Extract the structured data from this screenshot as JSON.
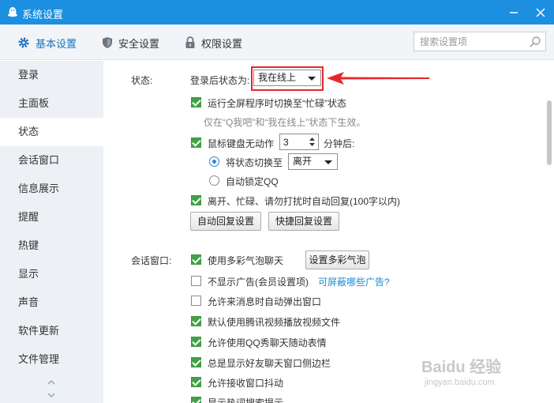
{
  "window": {
    "title": "系统设置"
  },
  "toolbar": {
    "tabs": [
      {
        "label": "基本设置",
        "icon": "gear-icon",
        "active": true
      },
      {
        "label": "安全设置",
        "icon": "shield-icon",
        "active": false
      },
      {
        "label": "权限设置",
        "icon": "lock-icon",
        "active": false
      }
    ],
    "search_placeholder": "搜索设置项"
  },
  "sidebar": {
    "items": [
      {
        "label": "登录"
      },
      {
        "label": "主面板"
      },
      {
        "label": "状态",
        "active": true
      },
      {
        "label": "会话窗口"
      },
      {
        "label": "信息展示"
      },
      {
        "label": "提醒"
      },
      {
        "label": "热键"
      },
      {
        "label": "显示"
      },
      {
        "label": "声音"
      },
      {
        "label": "软件更新"
      },
      {
        "label": "文件管理"
      }
    ]
  },
  "status_section": {
    "label": "状态:",
    "login_status_label": "登录后状态为:",
    "login_status_value": "我在线上",
    "fullscreen_busy": {
      "label": "运行全屏程序时切换至“忙碌”状态",
      "checked": true
    },
    "fullscreen_hint": "仅在“Q我吧”和“我在线上”状态下生效。",
    "idle": {
      "label": "鼠标键盘无动作",
      "checked": true,
      "minutes": "3",
      "suffix": "分钟后:"
    },
    "switch_to": {
      "label": "将状态切换至",
      "value": "离开",
      "selected": true
    },
    "auto_lock": {
      "label": "自动锁定QQ",
      "selected": false
    },
    "auto_reply": {
      "label": "离开、忙碌、请勿打扰时自动回复(100字以内)",
      "checked": true
    },
    "auto_reply_button": "自动回复设置",
    "quick_reply_button": "快捷回复设置"
  },
  "session_section": {
    "label": "会话窗口:",
    "options": [
      {
        "label": "使用多彩气泡聊天",
        "checked": true
      },
      {
        "label": "不显示广告(会员设置项)",
        "checked": false
      },
      {
        "label": "允许来消息时自动弹出窗口",
        "checked": false
      },
      {
        "label": "默认使用腾讯视频播放视频文件",
        "checked": true
      },
      {
        "label": "允许使用QQ秀聊天随动表情",
        "checked": true
      },
      {
        "label": "总是显示好友聊天窗口侧边栏",
        "checked": true
      },
      {
        "label": "允许接收窗口抖动",
        "checked": true
      },
      {
        "label": "显示热词搜索提示",
        "checked": true
      }
    ],
    "bubble_button": "设置多彩气泡",
    "ads_link": "可屏蔽哪些广告?"
  },
  "watermark": {
    "text": "Baidu 经验",
    "sub": "jingyan.baidu.com"
  },
  "colors": {
    "titlebar": "#1c8fe0",
    "accent": "#1a75c2",
    "check": "#43a047",
    "annotation": "#e8262a"
  }
}
